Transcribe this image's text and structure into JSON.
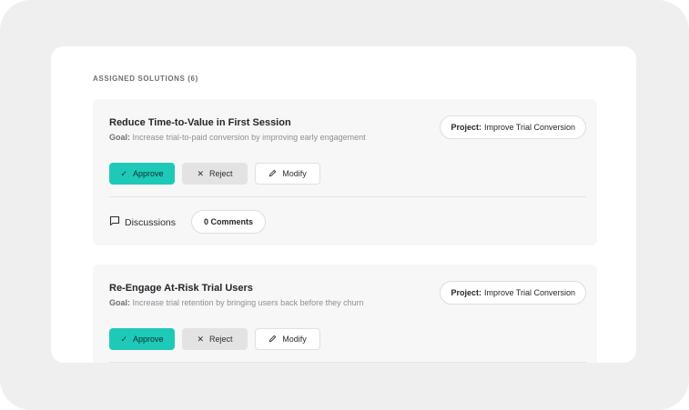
{
  "section": {
    "heading": "ASSIGNED SOLUTIONS (6)"
  },
  "solutions": [
    {
      "title": "Reduce Time-to-Value in First Session",
      "goal_label": "Goal:",
      "goal_text": " Increase trial-to-paid conversion by improving early engagement",
      "project_label": "Project:",
      "project_value": "Improve Trial Conversion",
      "approve_label": "Approve",
      "reject_label": "Reject",
      "modify_label": "Modify",
      "discussions_label": "Discussions",
      "comments_label": "0 Comments"
    },
    {
      "title": "Re-Engage At-Risk Trial Users",
      "goal_label": "Goal:",
      "goal_text": " Increase trial retention by bringing users back before they churn",
      "project_label": "Project:",
      "project_value": "Improve Trial Conversion",
      "approve_label": "Approve",
      "reject_label": "Reject",
      "modify_label": "Modify"
    }
  ],
  "colors": {
    "accent": "#1ec9b8",
    "outer_background": "#efefef",
    "card_background": "#f7f7f7"
  },
  "icons": {
    "approve": "check-icon",
    "reject": "x-icon",
    "modify": "pencil-icon",
    "discussions": "chat-bubble-icon"
  }
}
